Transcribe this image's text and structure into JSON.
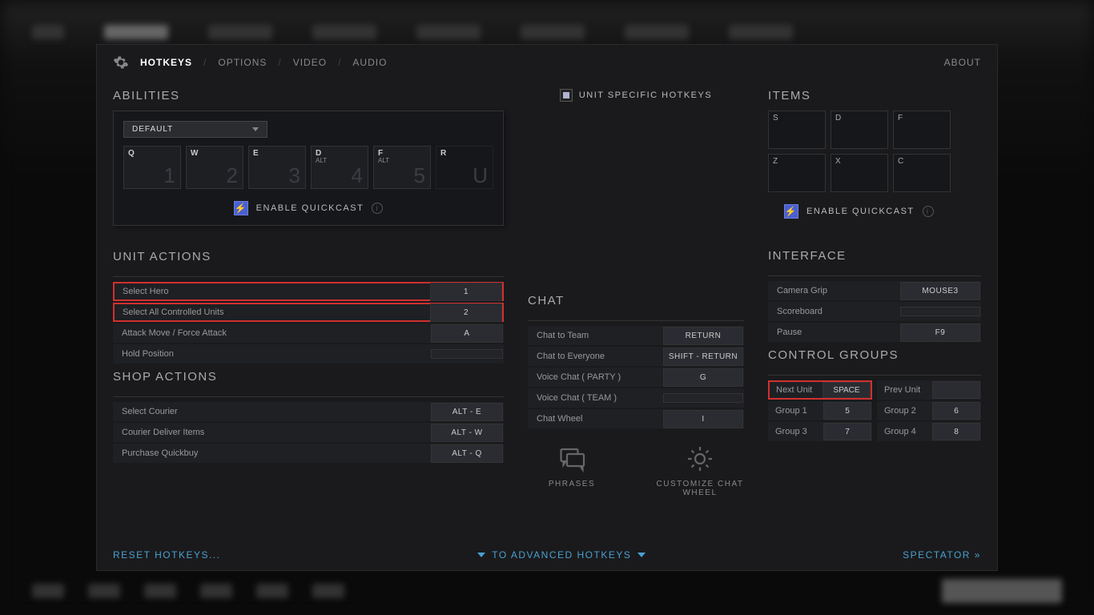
{
  "nav": {
    "tabs": [
      "HOTKEYS",
      "OPTIONS",
      "VIDEO",
      "AUDIO"
    ],
    "active": 0,
    "about": "ABOUT"
  },
  "abilities": {
    "title": "ABILITIES",
    "preset": "DEFAULT",
    "unit_specific": "UNIT SPECIFIC HOTKEYS",
    "enable_quickcast": "ENABLE QUICKCAST",
    "slots": [
      {
        "key": "Q",
        "sub": "",
        "num": "1"
      },
      {
        "key": "W",
        "sub": "",
        "num": "2"
      },
      {
        "key": "E",
        "sub": "",
        "num": "3"
      },
      {
        "key": "D",
        "sub": "ALT",
        "num": "4"
      },
      {
        "key": "F",
        "sub": "ALT",
        "num": "5"
      },
      {
        "key": "R",
        "sub": "",
        "num": "U"
      }
    ]
  },
  "items": {
    "title": "ITEMS",
    "enable_quickcast": "ENABLE QUICKCAST",
    "slots": [
      {
        "key": "S"
      },
      {
        "key": "D"
      },
      {
        "key": "F"
      },
      {
        "key": "Z"
      },
      {
        "key": "X"
      },
      {
        "key": "C"
      }
    ]
  },
  "unit_actions": {
    "title": "UNIT ACTIONS",
    "rows": [
      {
        "label": "Select Hero",
        "key": "1",
        "highlight": true
      },
      {
        "label": "Select All Controlled Units",
        "key": "2",
        "highlight": true
      },
      {
        "label": "Attack Move / Force Attack",
        "key": "A"
      },
      {
        "label": "Hold Position",
        "key": ""
      }
    ]
  },
  "shop_actions": {
    "title": "SHOP ACTIONS",
    "rows": [
      {
        "label": "Select Courier",
        "key": "ALT - E"
      },
      {
        "label": "Courier Deliver Items",
        "key": "ALT - W"
      },
      {
        "label": "Purchase Quickbuy",
        "key": "ALT - Q"
      }
    ]
  },
  "chat": {
    "title": "CHAT",
    "rows": [
      {
        "label": "Chat to Team",
        "key": "RETURN"
      },
      {
        "label": "Chat to Everyone",
        "key": "SHIFT - RETURN"
      },
      {
        "label": "Voice Chat ( PARTY )",
        "key": "G"
      },
      {
        "label": "Voice Chat ( TEAM )",
        "key": ""
      },
      {
        "label": "Chat Wheel",
        "key": "I"
      }
    ],
    "phrases": "PHRASES",
    "customize": "CUSTOMIZE CHAT WHEEL"
  },
  "interface": {
    "title": "INTERFACE",
    "rows": [
      {
        "label": "Camera Grip",
        "key": "MOUSE3"
      },
      {
        "label": "Scoreboard",
        "key": ""
      },
      {
        "label": "Pause",
        "key": "F9"
      }
    ]
  },
  "control_groups": {
    "title": "CONTROL GROUPS",
    "next": {
      "label": "Next Unit",
      "key": "SPACE",
      "highlight": true
    },
    "prev": {
      "label": "Prev Unit",
      "key": ""
    },
    "groups": [
      {
        "label": "Group 1",
        "key": "5"
      },
      {
        "label": "Group 2",
        "key": "6"
      },
      {
        "label": "Group 3",
        "key": "7"
      },
      {
        "label": "Group 4",
        "key": "8"
      }
    ]
  },
  "footer": {
    "reset": "RESET HOTKEYS...",
    "advanced": "TO ADVANCED HOTKEYS",
    "spectator": "SPECTATOR"
  }
}
